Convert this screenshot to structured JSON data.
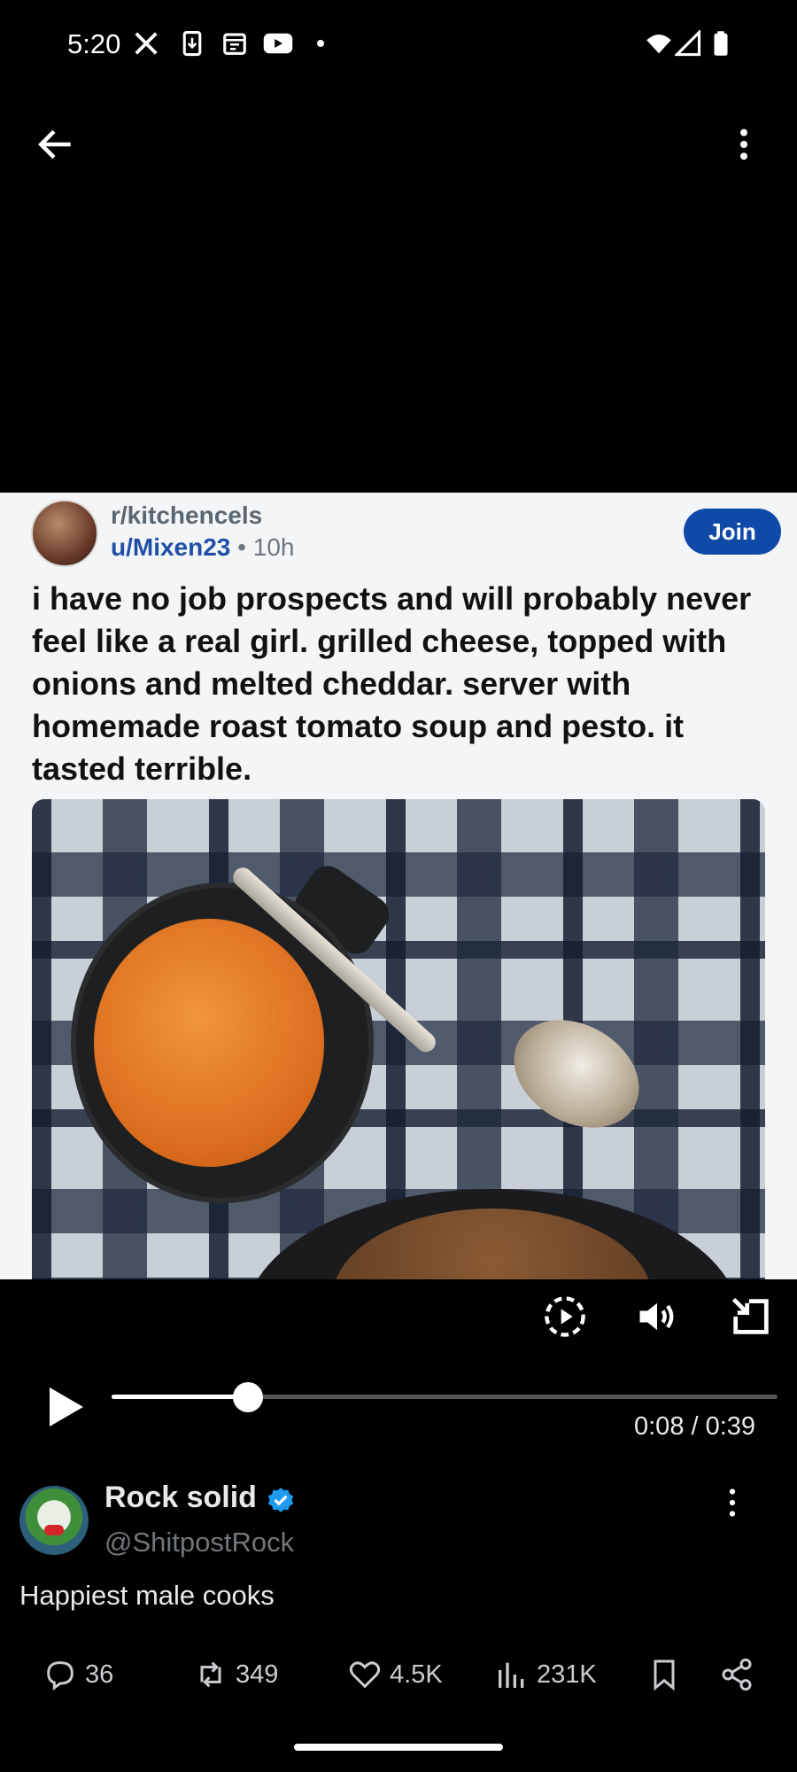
{
  "status_bar": {
    "time": "5:20",
    "left_icons": [
      "x-logo-icon",
      "download-icon",
      "calendar-icon",
      "youtube-icon",
      "dot-icon"
    ],
    "right_icons": [
      "wifi-icon",
      "signal-icon",
      "battery-icon"
    ]
  },
  "top_nav": {
    "back_icon": "arrow-left-icon",
    "more_icon": "more-vertical-icon"
  },
  "embedded_post": {
    "subreddit": "r/kitchencels",
    "username": "u/Mixen23",
    "separator": " • ",
    "age": "10h",
    "join_label": "Join",
    "text": "i have no job prospects and will probably never feel like a real girl. grilled cheese, topped with onions and melted cheddar. server with homemade roast tomato soup and pesto. it tasted terrible."
  },
  "video": {
    "progress": 0.205,
    "time_display": "0:08 / 0:39",
    "controls": [
      "autoplay-icon",
      "volume-icon",
      "exit-fullscreen-icon",
      "play-icon"
    ]
  },
  "tweet": {
    "display_name": "Rock solid",
    "handle": "@ShitpostRock",
    "text": "Happiest male cooks",
    "actions": {
      "replies": "36",
      "reposts": "349",
      "likes": "4.5K",
      "views": "231K"
    }
  },
  "colors": {
    "background": "#000000",
    "verified_blue": "#1d9bf0",
    "join_button": "#0f4aa8",
    "muted_text": "#71767b"
  }
}
